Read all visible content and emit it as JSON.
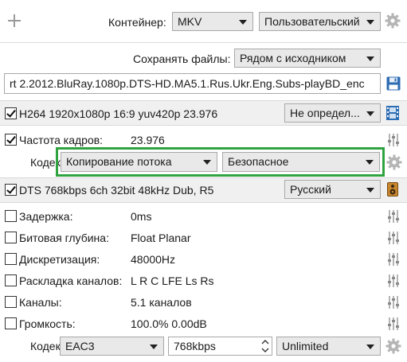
{
  "toolbar": {
    "add_icon": "plus-icon",
    "container_label": "Контейнер:",
    "container_value": "MKV",
    "preset_value": "Пользовательский",
    "settings_icon": "gear-icon"
  },
  "output": {
    "save_label": "Сохранять файлы:",
    "save_value": "Рядом с исходником",
    "filename": "rt 2.2012.BluRay.1080p.DTS-HD.MA5.1.Rus.Ukr.Eng.Subs-playBD_enc",
    "save_icon": "floppy-disk-icon"
  },
  "video": {
    "checked": true,
    "title": "H264 1920x1080p 16:9 yuv420p 23.976",
    "language": "Не определ...",
    "icon": "film-strip-icon",
    "framerate_label": "Частота кадров:",
    "framerate_value": "23.976",
    "framerate_checked": true,
    "codec_label": "Кодек:",
    "codec_value": "Копирование потока",
    "mode_value": "Безопасное"
  },
  "audio": {
    "checked": true,
    "title": "DTS 768kbps 6ch 32bit 48kHz Dub, R5",
    "language": "Русский",
    "icon": "speaker-icon",
    "rows": [
      {
        "label": "Задержка:",
        "value": "0ms",
        "checked": false
      },
      {
        "label": "Битовая глубина:",
        "value": "Float Planar",
        "checked": false
      },
      {
        "label": "Дискретизация:",
        "value": "48000Hz",
        "checked": false
      },
      {
        "label": "Раскладка каналов:",
        "value": "L R C LFE Ls Rs",
        "checked": false
      },
      {
        "label": "Каналы:",
        "value": "5.1 каналов",
        "checked": false
      },
      {
        "label": "Громкость:",
        "value": "100.0% 0.00dB",
        "checked": false
      }
    ],
    "codec_label": "Кодек:",
    "codec_value": "EAC3",
    "bitrate_value": "768kbps",
    "quality_value": "Unlimited"
  },
  "colors": {
    "highlight": "#2fa33f",
    "band": "#f0f0f0",
    "combo": "#e9e9e9"
  }
}
